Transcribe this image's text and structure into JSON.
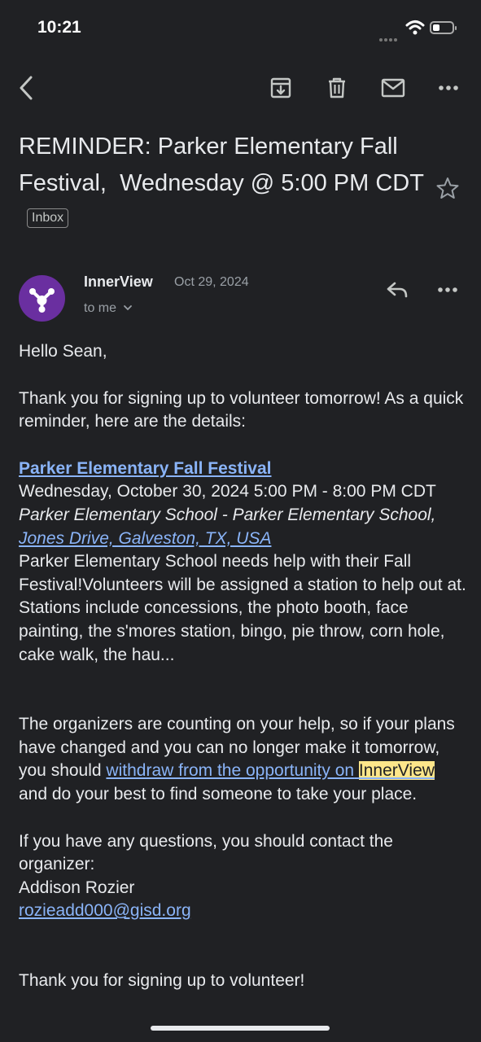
{
  "status": {
    "time": "10:21"
  },
  "email": {
    "subject": "REMINDER: Parker Elementary Fall Festival,  Wednesday @ 5:00 PM CDT",
    "label": "Inbox",
    "sender": "InnerView",
    "date": "Oct 29, 2024",
    "recipient": "to me"
  },
  "body": {
    "greeting": "Hello Sean,",
    "intro": "Thank you for signing up to volunteer tomorrow! As a quick reminder, here are the details:",
    "event_title": "Parker Elementary Fall Festival",
    "event_datetime": "Wednesday, October 30, 2024 5:00 PM - 8:00 PM CDT",
    "location_name": "Parker Elementary School - Parker Elementary School,",
    "location_address": "Jones Drive, Galveston, TX, USA",
    "description": "Parker Elementary School needs help with their Fall Festival!Volunteers will be assigned a station to help out at. Stations include concessions, the photo booth, face painting, the s'mores station, bingo, pie throw, corn hole, cake walk, the hau...",
    "organizers_prefix": "The organizers are counting on your help, so if your plans have changed and you can no longer make it tomorrow, you should",
    "withdraw_link": "withdraw from the opportunity on",
    "brand_highlight": "InnerView",
    "organizers_suffix": "and do your best to find someone to take your place.",
    "questions": "If you have any questions, you should contact the organizer:",
    "organizer_name": "Addison Rozier",
    "organizer_email": "rozieadd000@gisd.org",
    "closing": "Thank you for signing up to volunteer!"
  },
  "colors": {
    "background": "#202124",
    "link": "#8ab4f8",
    "avatar": "#6a2fa0",
    "highlight": "#fde68a"
  },
  "icons": [
    "back-arrow-icon",
    "archive-icon",
    "trash-icon",
    "mail-icon",
    "more-icon",
    "star-icon",
    "reply-icon",
    "chevron-down-icon",
    "wifi-icon",
    "battery-icon"
  ]
}
